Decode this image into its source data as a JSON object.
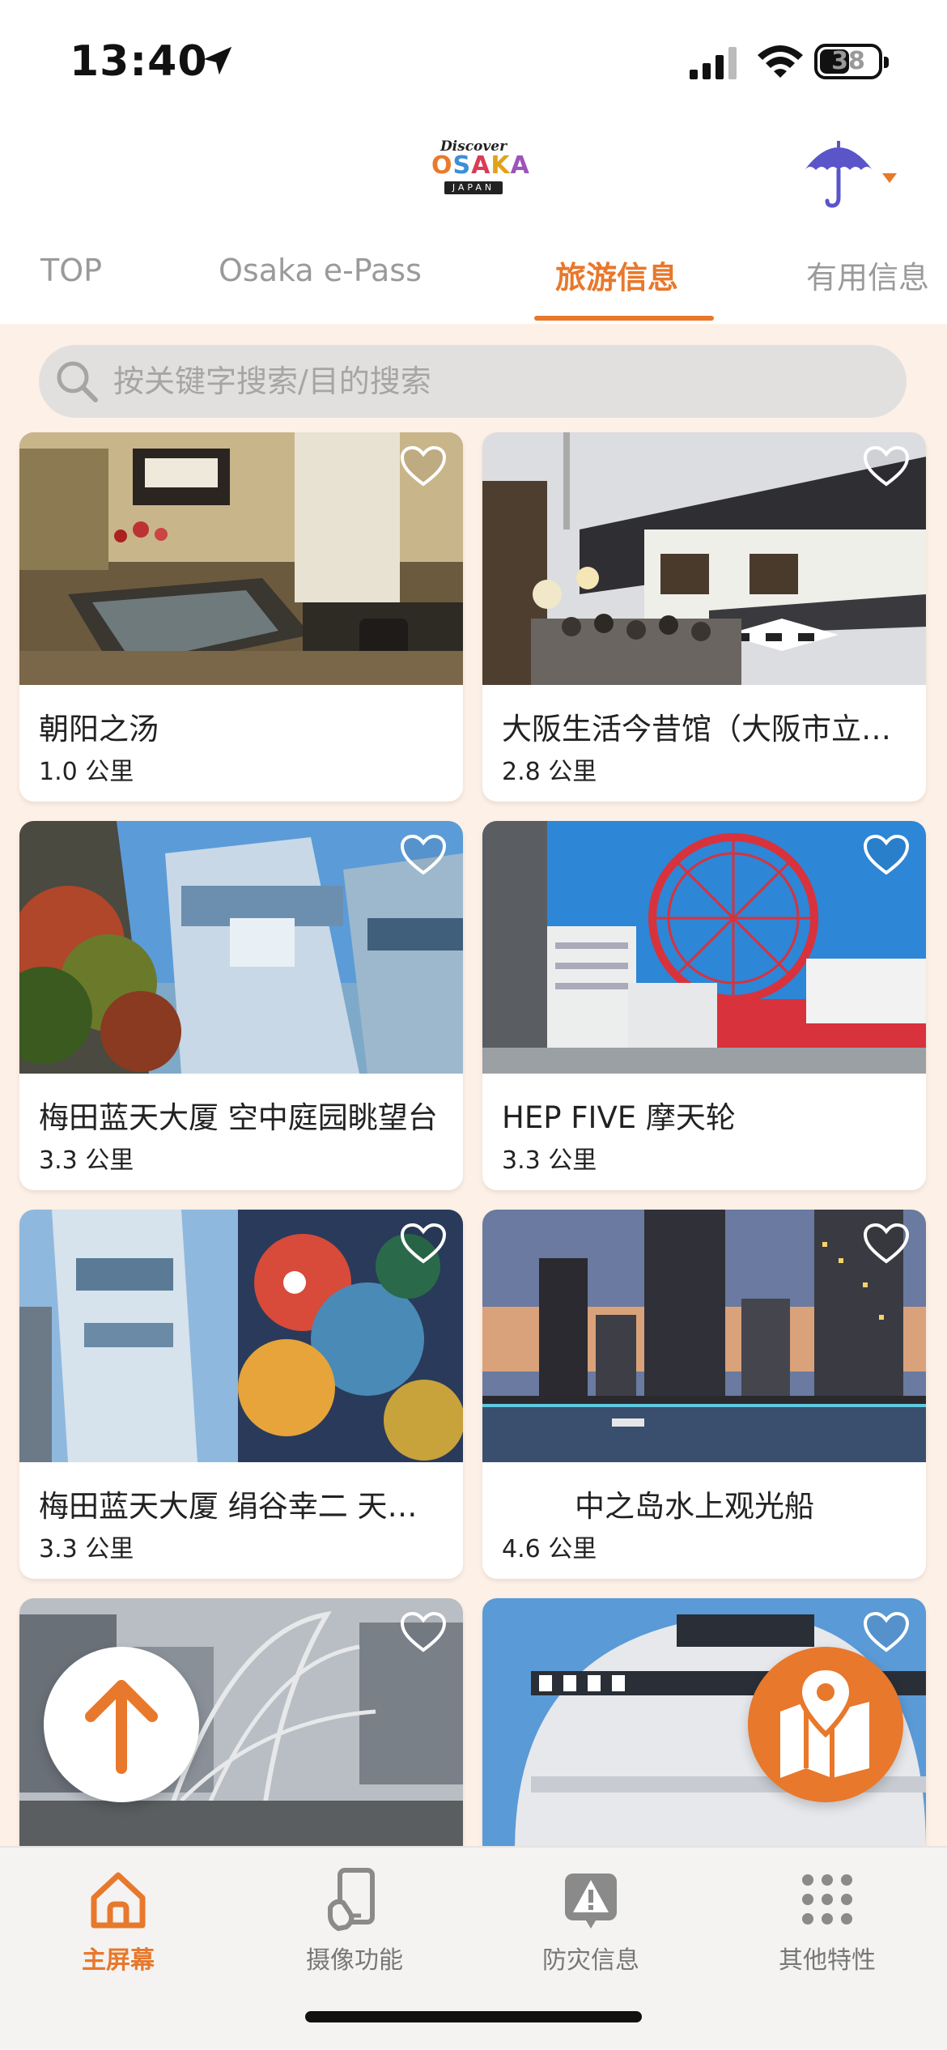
{
  "status_bar": {
    "time": "13:40",
    "battery": "38",
    "battery_fraction": 0.38
  },
  "header": {
    "logo": {
      "line1": "Discover",
      "line2_parts": [
        "O",
        "S",
        "A",
        "K",
        "A"
      ],
      "line3": "JAPAN"
    },
    "weather_icon": "umbrella-icon"
  },
  "tabs": [
    {
      "label": "TOP",
      "active": false
    },
    {
      "label": "Osaka e-Pass",
      "active": false
    },
    {
      "label": "旅游信息",
      "active": true
    },
    {
      "label": "有用信息",
      "active": false
    }
  ],
  "search": {
    "placeholder": "按关键字搜索/目的搜索",
    "value": ""
  },
  "cards": [
    {
      "title": "朝阳之汤",
      "distance": "1.0 公里"
    },
    {
      "title": "大阪生活今昔馆（大阪市立住まいのミュージアム）",
      "distance": "2.8 公里"
    },
    {
      "title": "梅田蓝天大厦 空中庭园眺望台",
      "distance": "3.3 公里"
    },
    {
      "title": "HEP FIVE 摩天轮",
      "distance": "3.3 公里"
    },
    {
      "title": "梅田蓝天大厦 绢谷幸二 天空美术馆",
      "distance": "3.3 公里"
    },
    {
      "title": "中之岛水上观光船",
      "distance": "4.6 公里"
    },
    {
      "title": "",
      "distance": ""
    },
    {
      "title": "",
      "distance": ""
    }
  ],
  "bottom_nav": [
    {
      "label": "主屏幕",
      "icon": "home-icon",
      "active": true
    },
    {
      "label": "摄像功能",
      "icon": "camera-phone-icon",
      "active": false
    },
    {
      "label": "防灾信息",
      "icon": "warning-icon",
      "active": false
    },
    {
      "label": "其他特性",
      "icon": "grid-icon",
      "active": false
    }
  ],
  "colors": {
    "accent": "#e8782b",
    "content_bg": "#fdf0e6",
    "search_bg": "#e2e0df",
    "nav_bg": "#f4f3f2"
  }
}
